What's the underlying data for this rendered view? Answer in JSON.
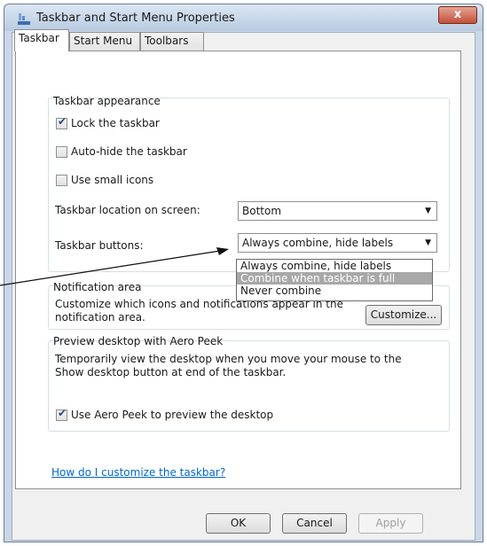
{
  "window": {
    "title": "Taskbar and Start Menu Properties",
    "close_label": "x"
  },
  "tabs": [
    "Taskbar",
    "Start Menu",
    "Toolbars"
  ],
  "appearance": {
    "title": "Taskbar appearance",
    "lock": {
      "label": "Lock the taskbar",
      "checked": true
    },
    "autohide": {
      "label": "Auto-hide the taskbar",
      "checked": false
    },
    "small_icons": {
      "label": "Use small icons",
      "checked": false
    },
    "location_label": "Taskbar location on screen:",
    "location_value": "Bottom",
    "buttons_label": "Taskbar buttons:",
    "buttons_value": "Always combine, hide labels",
    "buttons_options": [
      "Always combine, hide labels",
      "Combine when taskbar is full",
      "Never combine"
    ],
    "buttons_highlighted_index": 1
  },
  "notification": {
    "title": "Notification area",
    "description": "Customize which icons and notifications appear in the notification area.",
    "customize_label": "Customize..."
  },
  "aero_peek": {
    "title": "Preview desktop with Aero Peek",
    "description": "Temporarily view the desktop when you move your mouse to the Show desktop button at end of the taskbar.",
    "use_peek": {
      "label": "Use Aero Peek to preview the desktop",
      "checked": true
    }
  },
  "help_link": "How do I customize the taskbar?",
  "footer": {
    "ok": "OK",
    "cancel": "Cancel",
    "apply": "Apply"
  },
  "colors": {
    "link": "#0066cc",
    "highlight": "#a8a8a8"
  }
}
